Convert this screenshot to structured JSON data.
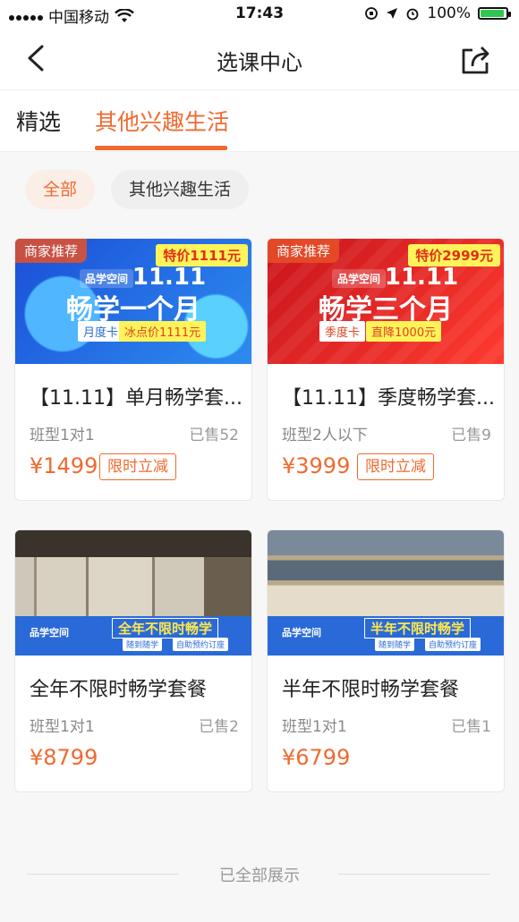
{
  "status_bar": {
    "carrier": "中国移动",
    "time": "17:43",
    "battery": "100%"
  },
  "nav": {
    "title": "选课中心",
    "back_icon": "chevron-left-icon",
    "share_icon": "share-icon"
  },
  "tabs": [
    {
      "label": "精选"
    },
    {
      "label": "其他兴趣生活"
    }
  ],
  "chips": [
    {
      "label": "全部"
    },
    {
      "label": "其他兴趣生活"
    }
  ],
  "courses": [
    {
      "badge": "商家推荐",
      "special_price": "特价1111元",
      "banner_event": "11.11",
      "banner_title": "畅学一个月",
      "banner_card": "月度卡",
      "banner_deal": "冰点价1111元",
      "banner_logo": "品学空间",
      "name": "【11.11】单月畅学套...",
      "type": "班型1对1",
      "sold": "已售52",
      "price": "¥1499",
      "promo": "限时立减"
    },
    {
      "badge": "商家推荐",
      "special_price": "特价2999元",
      "banner_event": "11.11",
      "banner_title": "畅学三个月",
      "banner_card": "季度卡",
      "banner_deal": "直降1000元",
      "banner_logo": "品学空间",
      "name": "【11.11】季度畅学套...",
      "type": "班型2人以下",
      "sold": "已售9",
      "price": "¥3999",
      "promo": "限时立减"
    },
    {
      "banner_slogan": "全年不限时畅学",
      "banner_feat1": "随到随学",
      "banner_feat2": "自助预约订座",
      "banner_logo": "品学空间",
      "name": "全年不限时畅学套餐",
      "type": "班型1对1",
      "sold": "已售2",
      "price": "¥8799"
    },
    {
      "banner_slogan": "半年不限时畅学",
      "banner_feat1": "随到随学",
      "banner_feat2": "自助预约订座",
      "banner_logo": "品学空间",
      "name": "半年不限时畅学套餐",
      "type": "班型1对1",
      "sold": "已售1",
      "price": "¥6799"
    }
  ],
  "footer": {
    "text": "已全部展示"
  },
  "colors": {
    "accent": "#f06a30",
    "blue_banner": "#2a6ad8",
    "red_banner": "#e02a2a"
  }
}
